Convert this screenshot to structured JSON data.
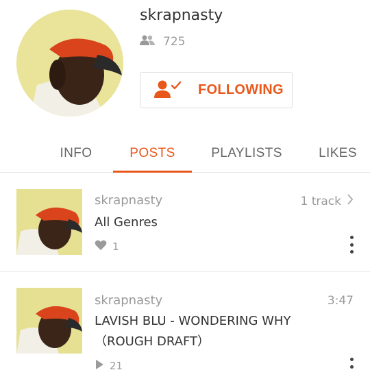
{
  "profile": {
    "username": "skrapnasty",
    "followers_count": "725",
    "follow_button_label": "FOLLOWING"
  },
  "tabs": [
    {
      "label": "INFO"
    },
    {
      "label": "POSTS"
    },
    {
      "label": "PLAYLISTS"
    },
    {
      "label": "LIKES"
    }
  ],
  "active_tab": "POSTS",
  "posts": [
    {
      "user": "skrapnasty",
      "title": "All Genres",
      "right_label": "1 track",
      "stat_value": "1",
      "stat_icon": "heart-icon"
    },
    {
      "user": "skrapnasty",
      "title_line1": "LAVISH BLU - WONDERING WHY",
      "title_line2": "（ROUGH DRAFT）",
      "right_label": "3:47",
      "stat_value": "21",
      "stat_icon": "play-icon"
    }
  ],
  "colors": {
    "accent": "#e8581b",
    "text_primary": "#333333",
    "text_secondary": "#999999"
  }
}
